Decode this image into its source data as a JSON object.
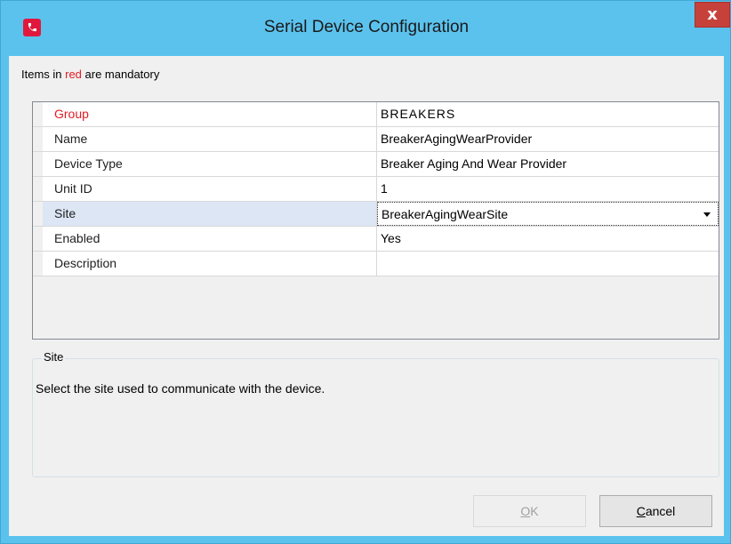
{
  "window": {
    "title": "Serial Device Configuration",
    "close_label": "x",
    "icon": "app-phone-icon"
  },
  "notice": {
    "prefix": "Items in ",
    "highlight": "red",
    "suffix": " are mandatory",
    "highlight_color": "#e31b23"
  },
  "properties": [
    {
      "name": "Group",
      "value": "BREAKERS",
      "mandatory": true
    },
    {
      "name": "Name",
      "value": "BreakerAgingWearProvider",
      "mandatory": false
    },
    {
      "name": "Device Type",
      "value": "Breaker Aging And Wear Provider",
      "mandatory": false
    },
    {
      "name": "Unit ID",
      "value": "1",
      "mandatory": false
    },
    {
      "name": "Site",
      "value": "BreakerAgingWearSite",
      "mandatory": false,
      "selected": true,
      "dropdown": true
    },
    {
      "name": "Enabled",
      "value": "Yes",
      "mandatory": false
    },
    {
      "name": "Description",
      "value": "",
      "mandatory": false
    }
  ],
  "help": {
    "title": "Site",
    "text": "Select the site used to communicate with the device."
  },
  "buttons": {
    "ok_mnemonic": "O",
    "ok_rest": "K",
    "ok_enabled": false,
    "cancel_mnemonic": "C",
    "cancel_rest": "ancel"
  },
  "colors": {
    "titlebar": "#5bc2ee",
    "close": "#c7413b",
    "selected_row": "#dde6f5"
  }
}
